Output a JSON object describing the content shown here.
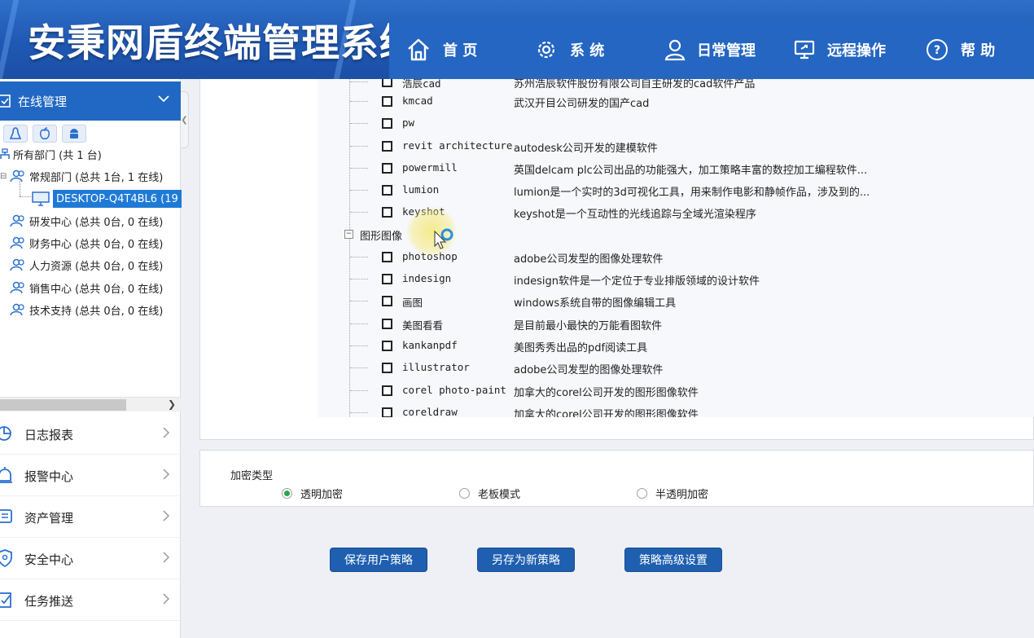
{
  "brand": {
    "title": "安秉网盾终端管理系统"
  },
  "nav": [
    {
      "label": "首  页",
      "icon": "home-icon"
    },
    {
      "label": "系  统",
      "icon": "gear-icon"
    },
    {
      "label": "日常管理",
      "icon": "user-icon"
    },
    {
      "label": "远程操作",
      "icon": "remote-screen-icon"
    },
    {
      "label": "帮  助",
      "icon": "help-icon"
    }
  ],
  "sidebar": {
    "header": "在线管理",
    "os_filters": [
      "linux-icon",
      "apple-icon",
      "android-icon"
    ],
    "tree": {
      "root": "所有部门 (共 1 台)",
      "departments": [
        {
          "label": "常规部门 (总共 1台, 1 在线)"
        },
        {
          "label": "研发中心 (总共 0台, 0 在线)"
        },
        {
          "label": "财务中心 (总共 0台, 0 在线)"
        },
        {
          "label": "人力资源 (总共 0台, 0 在线)"
        },
        {
          "label": "销售中心 (总共 0台, 0 在线)"
        },
        {
          "label": "技术支持 (总共 0台, 0 在线)"
        }
      ],
      "computer": "DESKTOP-Q4T4BL6 (19"
    },
    "menu": [
      {
        "label": "日志报表",
        "icon": "report-icon"
      },
      {
        "label": "报警中心",
        "icon": "alarm-icon"
      },
      {
        "label": "资产管理",
        "icon": "asset-icon"
      },
      {
        "label": "安全中心",
        "icon": "shield-icon"
      },
      {
        "label": "任务推送",
        "icon": "task-icon"
      }
    ]
  },
  "software": {
    "partial_top": {
      "name": "浩辰cad",
      "desc": "苏州浩辰软件股份有限公司自主研发的cad软件产品"
    },
    "cad_items": [
      {
        "name": "kmcad",
        "desc": "武汉开目公司研发的国产cad"
      },
      {
        "name": "pw",
        "desc": ""
      },
      {
        "name": "revit architecture",
        "desc": "autodesk公司开发的建模软件"
      },
      {
        "name": "powermill",
        "desc": "英国delcam plc公司出品的功能强大，加工策略丰富的数控加工编程软件..."
      },
      {
        "name": "lumion",
        "desc": "lumion是一个实时的3d可视化工具，用来制作电影和静帧作品，涉及到的..."
      },
      {
        "name": "keyshot",
        "desc": "keyshot是一个互动性的光线追踪与全域光渲染程序"
      }
    ],
    "category": "图形图像",
    "graphics_items": [
      {
        "name": "photoshop",
        "desc": "adobe公司发型的图像处理软件"
      },
      {
        "name": "indesign",
        "desc": "indesign软件是一个定位于专业排版领域的设计软件"
      },
      {
        "name": "画图",
        "desc": "windows系统自带的图像编辑工具"
      },
      {
        "name": "美图看看",
        "desc": "是目前最小最快的万能看图软件"
      },
      {
        "name": "kankanpdf",
        "desc": "美图秀秀出品的pdf阅读工具"
      },
      {
        "name": "illustrator",
        "desc": "adobe公司发型的图像处理软件"
      },
      {
        "name": "corel photo-paint",
        "desc": "加拿大的corel公司开发的图形图像软件"
      },
      {
        "name": "coreldraw",
        "desc": "加拿大的corel公司开发的图形图像软件"
      }
    ]
  },
  "encryption": {
    "title": "加密类型",
    "options": [
      {
        "label": "透明加密",
        "selected": true
      },
      {
        "label": "老板模式",
        "selected": false
      },
      {
        "label": "半透明加密",
        "selected": false
      }
    ]
  },
  "buttons": {
    "save": "保存用户策略",
    "save_as": "另存为新策略",
    "advanced": "策略高级设置"
  },
  "colors": {
    "header": "#1f58b3",
    "nav": "#2466c2",
    "accent": "#2168c4",
    "button": "#1f5fb0",
    "radio_selected": "#2ea34a"
  }
}
